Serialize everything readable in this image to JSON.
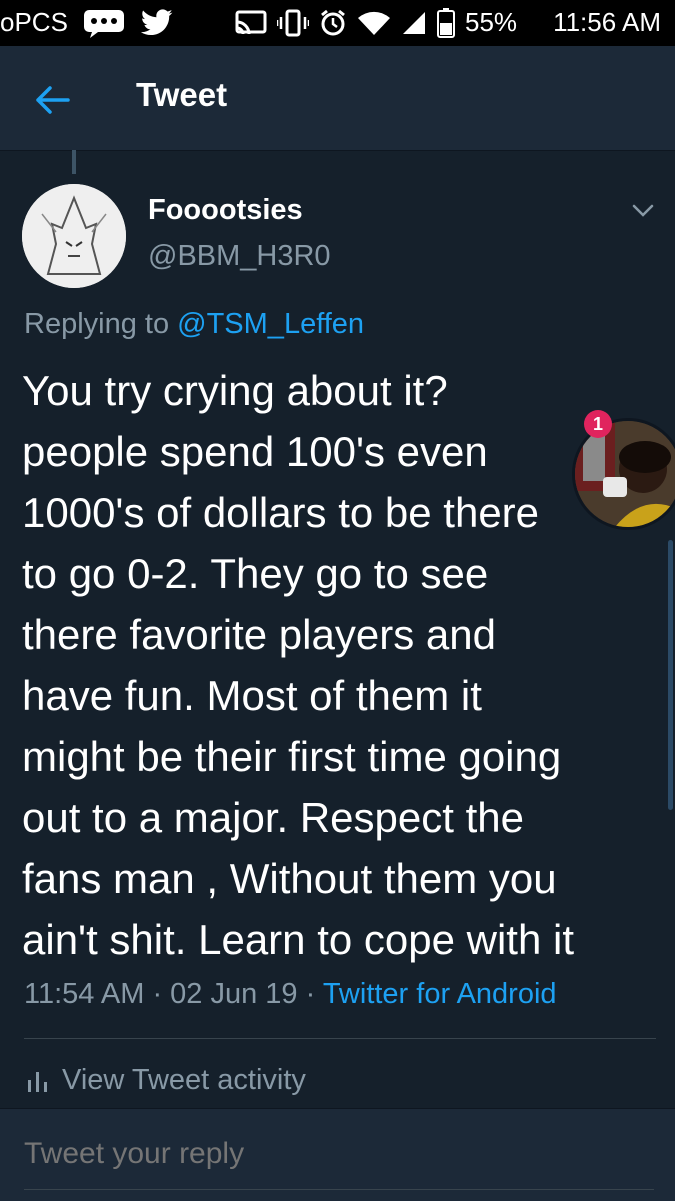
{
  "status_bar": {
    "carrier": "oPCS",
    "battery": "55%",
    "time": "11:56 AM"
  },
  "app_bar": {
    "title": "Tweet"
  },
  "tweet": {
    "author_name": "Fooootsies",
    "author_handle": "@BBM_H3R0",
    "replying_prefix": "Replying to",
    "replying_to": "@TSM_Leffen",
    "text_lines": [
      "You try crying about it?",
      "people spend 100's even",
      "1000's of dollars to be there",
      "to go 0-2. They go to see",
      "there favorite players and",
      "have fun. Most of them it",
      "might be their first time going",
      "out to a major. Respect the",
      "fans man , Without them you",
      "ain't shit. Learn to cope with it"
    ],
    "time": "11:54 AM",
    "date": "02 Jun 19",
    "source": "Twitter for Android",
    "separator": " · "
  },
  "actions": {
    "view_activity": "View Tweet activity"
  },
  "reply": {
    "placeholder": "Tweet your reply"
  },
  "chat_head": {
    "badge": "1"
  },
  "colors": {
    "background": "#15202b",
    "app_bar": "#1c2938",
    "accent": "#1da1f2",
    "secondary_text": "#8899a6"
  }
}
